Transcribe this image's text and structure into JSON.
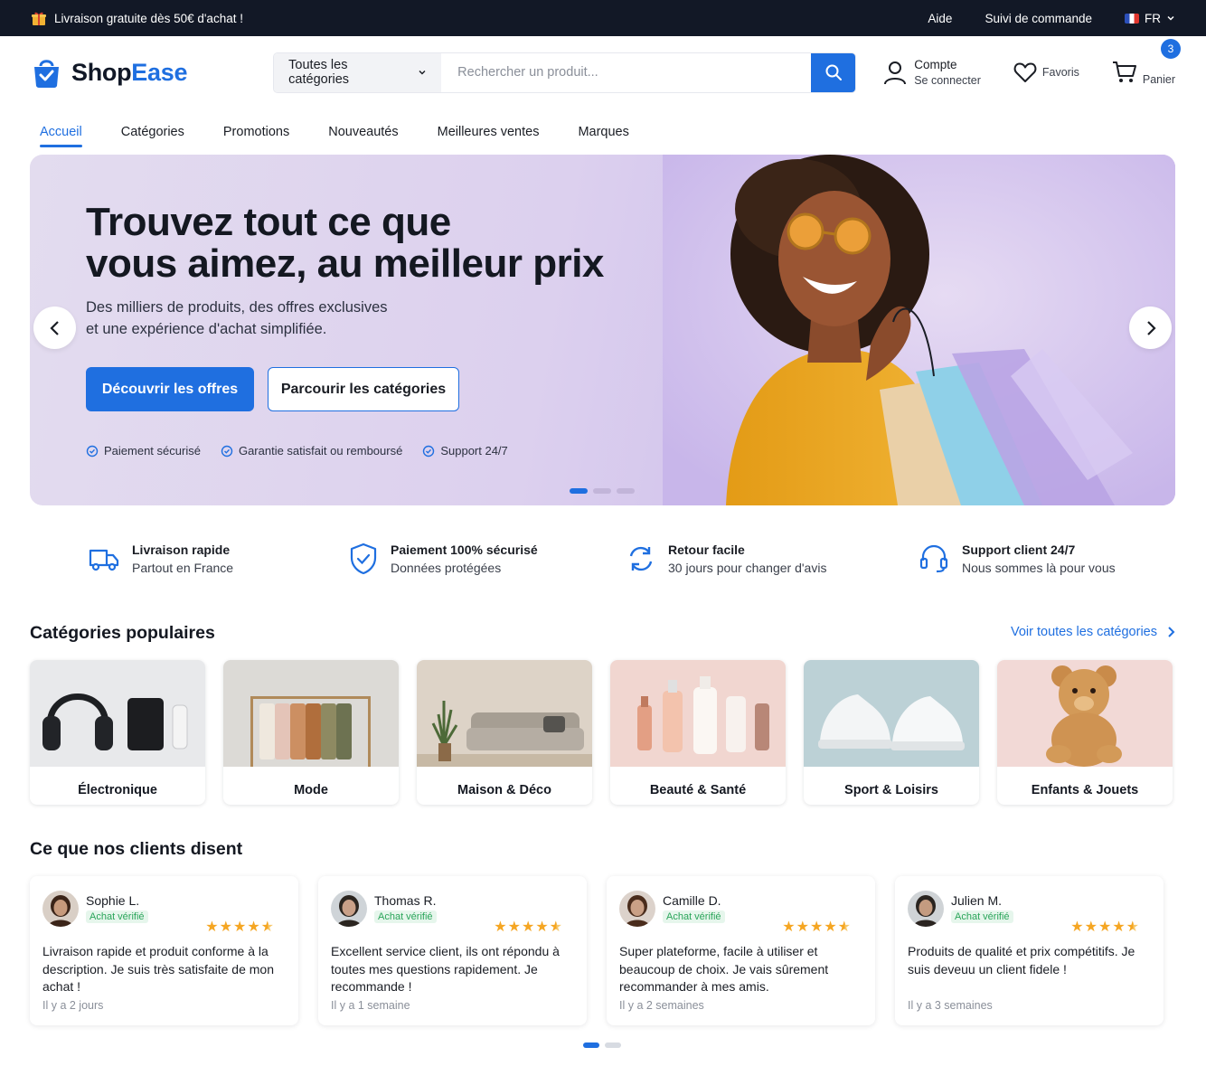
{
  "topbar": {
    "promo": "Livraison gratuite dès 50€ d'achat !",
    "help": "Aide",
    "order_tracking": "Suivi de commande",
    "language": "FR"
  },
  "header": {
    "brand_part1": "Shop",
    "brand_part2": "Ease",
    "category_select": "Toutes les catégories",
    "search_placeholder": "Rechercher un produit...",
    "account_title": "Compte",
    "account_sub": "Se connecter",
    "favorites": "Favoris",
    "cart_label": "Panier",
    "cart_count": "3"
  },
  "nav": {
    "items": [
      "Accueil",
      "Catégories",
      "Promotions",
      "Nouveautés",
      "Meilleures ventes",
      "Marques"
    ],
    "active_index": 0
  },
  "hero": {
    "title_line1": "Trouvez tout ce que",
    "title_line2": "vous aimez, au meilleur prix",
    "sub_line1": "Des milliers de produits, des offres exclusives",
    "sub_line2": "et une expérience d'achat simplifiée.",
    "cta_primary": "Découvrir les offres",
    "cta_secondary": "Parcourir les catégories",
    "trust": [
      "Paiement sécurisé",
      "Garantie satisfait ou remboursé",
      "Support 24/7"
    ],
    "slides_total": 3,
    "slide_active": 1
  },
  "features": [
    {
      "icon": "truck-icon",
      "title": "Livraison rapide",
      "sub": "Partout en France"
    },
    {
      "icon": "shield-check-icon",
      "title": "Paiement 100% sécurisé",
      "sub": "Données protégées"
    },
    {
      "icon": "refresh-icon",
      "title": "Retour facile",
      "sub": "30 jours pour changer d'avis"
    },
    {
      "icon": "headset-icon",
      "title": "Support client 24/7",
      "sub": "Nous sommes là pour vous"
    }
  ],
  "categories": {
    "title": "Catégories populaires",
    "see_all": "Voir toutes les catégories",
    "items": [
      "Électronique",
      "Mode",
      "Maison & Déco",
      "Beauté & Santé",
      "Sport & Loisirs",
      "Enfants & Jouets"
    ]
  },
  "reviews": {
    "title": "Ce que nos clients disent",
    "verified_label": "Achat vérifié",
    "items": [
      {
        "name": "Sophie L.",
        "rating": 4.5,
        "text": "Livraison rapide et produit conforme à la description. Je suis très satisfaite de mon achat !",
        "ago": "Il y a 2 jours"
      },
      {
        "name": "Thomas R.",
        "rating": 4.5,
        "text": "Excellent service client, ils ont répondu à toutes mes questions rapidement. Je recommande !",
        "ago": "Il y a 1 semaine"
      },
      {
        "name": "Camille D.",
        "rating": 4.5,
        "text": "Super plateforme, facile à utiliser et beaucoup de choix. Je vais sûrement recommander à mes amis.",
        "ago": "Il y a 2 semaines"
      },
      {
        "name": "Julien M.",
        "rating": 4.5,
        "text": "Produits de qualité et prix compétitifs. Je suis deveuu un client fidele !",
        "ago": "Il y a 3 semaines"
      }
    ],
    "pages_total": 2,
    "page_active": 1
  },
  "colors": {
    "accent": "#1f6fe0",
    "topbar_bg": "#121826",
    "star": "#f5a623",
    "verified": "#2aa55a"
  }
}
